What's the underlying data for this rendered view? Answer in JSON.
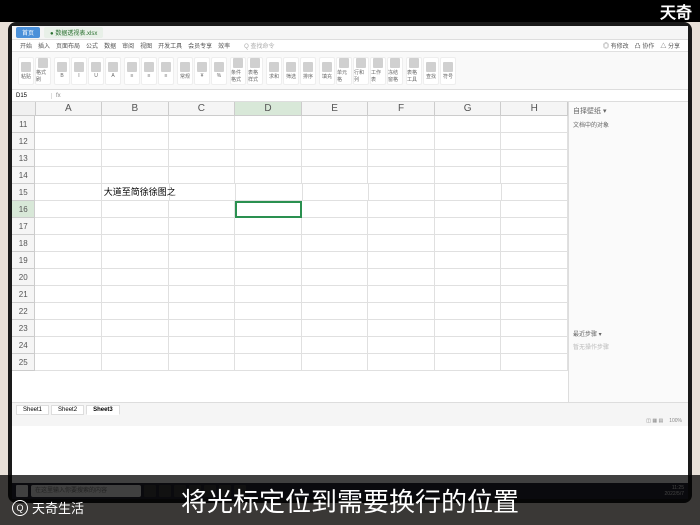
{
  "watermark": "天奇",
  "logo_text": "天奇生活",
  "logo_icon": "Q",
  "caption": "将光标定位到需要换行的位置",
  "titlebar": {
    "tab_active": "首页",
    "tab_file_icon": "●",
    "tab_file": "数据透视表.xlsx"
  },
  "ribbon_tabs": [
    "开始",
    "插入",
    "页面布局",
    "公式",
    "数据",
    "审阅",
    "视图",
    "开发工具",
    "会员专享",
    "效率"
  ],
  "ribbon_right": "Q 查找命令",
  "ribbon_far": [
    "◎ 有修改",
    "凸 协作",
    "△ 分享"
  ],
  "ribbon_groups": [
    [
      "粘贴",
      "格式刷"
    ],
    [
      "B",
      "I",
      "U",
      "A"
    ],
    [
      "≡",
      "≡",
      "≡"
    ],
    [
      "常规",
      "¥",
      "%"
    ],
    [
      "条件格式",
      "表格样式"
    ],
    [
      "求和",
      "筛选",
      "排序"
    ],
    [
      "填充",
      "单元格",
      "行和列",
      "工作表",
      "冻结窗格"
    ],
    [
      "表格工具",
      "查找",
      "符号"
    ]
  ],
  "cell_ref": "D15",
  "columns": [
    "A",
    "B",
    "C",
    "D",
    "E",
    "F",
    "G",
    "H"
  ],
  "selected_col": "D",
  "rows_start": 11,
  "rows_end": 25,
  "selected_row": 16,
  "cells": {
    "15": {
      "B": "大道至简徐徐图之"
    }
  },
  "active_cell": {
    "row": 16,
    "col": "D"
  },
  "side_panel": {
    "title": "自择壁纸 ▾",
    "item": "文档中的对象",
    "footer1": "最近步骤 ▾",
    "footer2": "暂无操作步骤"
  },
  "sheets": [
    "Sheet1",
    "Sheet2",
    "Sheet3"
  ],
  "active_sheet": "Sheet3",
  "status": {
    "zoom": "100%",
    "mode": "◫ ▦ ▤"
  },
  "taskbar": {
    "search_placeholder": "在这里输入你要搜索的内容",
    "time": "11:25",
    "date": "2022/5/7"
  }
}
